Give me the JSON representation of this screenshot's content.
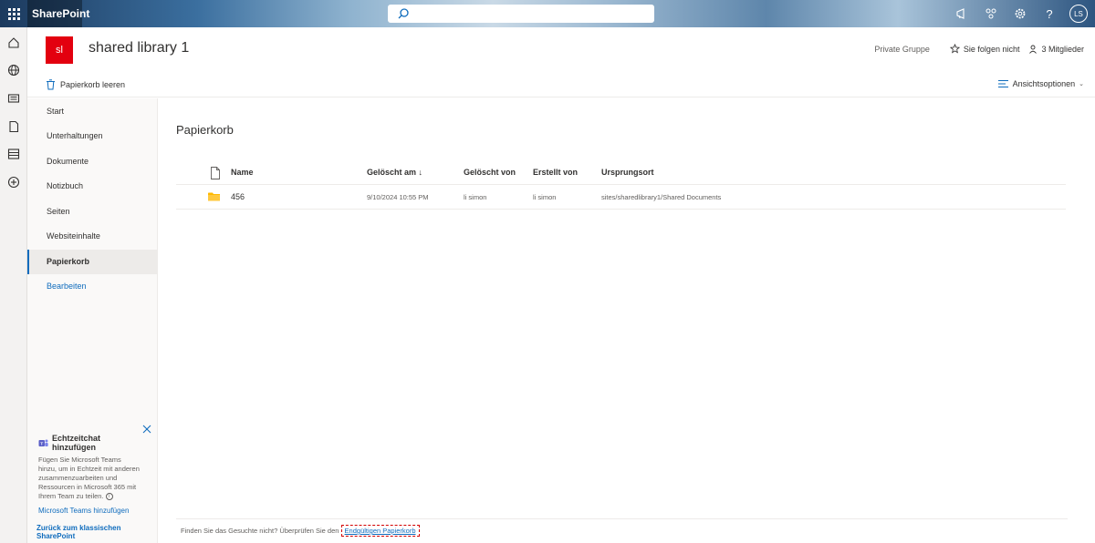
{
  "suite": {
    "brand": "SharePoint",
    "avatar_initials": "LS",
    "icons": [
      "megaphone-icon",
      "share-icon",
      "settings-icon",
      "help-icon"
    ],
    "help_glyph": "?"
  },
  "appbar": {
    "icons": [
      "home-icon",
      "globe-icon",
      "news-icon",
      "file-icon",
      "list-icon",
      "create-icon"
    ]
  },
  "site": {
    "logo_text": "sl",
    "title": "shared library 1",
    "privacy": "Private Gruppe",
    "follow": "Sie folgen nicht",
    "members": "3 Mitglieder"
  },
  "commandbar": {
    "empty_bin": "Papierkorb leeren",
    "view_options": "Ansichtsoptionen"
  },
  "nav": {
    "items": [
      {
        "label": "Start"
      },
      {
        "label": "Unterhaltungen"
      },
      {
        "label": "Dokumente"
      },
      {
        "label": "Notizbuch"
      },
      {
        "label": "Seiten"
      },
      {
        "label": "Websiteinhalte"
      },
      {
        "label": "Papierkorb"
      },
      {
        "label": "Bearbeiten"
      }
    ]
  },
  "teams_card": {
    "title": "Echtzeitchat hinzufügen",
    "body": "Fügen Sie Microsoft Teams hinzu, um in Echtzeit mit anderen zusammenzuarbeiten und Ressourcen in Microsoft 365 mit Ihrem Team zu teilen.",
    "link": "Microsoft Teams hinzufügen"
  },
  "classic_link": "Zurück zum klassischen SharePoint",
  "main": {
    "title": "Papierkorb",
    "columns": {
      "name": "Name",
      "deleted_on": "Gelöscht am ↓",
      "deleted_by": "Gelöscht von",
      "created_by": "Erstellt von",
      "origin": "Ursprungsort"
    },
    "rows": [
      {
        "name": "456",
        "deleted_on": "9/10/2024 10:55 PM",
        "deleted_by": "li simon",
        "created_by": "li simon",
        "origin": "sites/sharedlibrary1/Shared Documents"
      }
    ]
  },
  "footer": {
    "text": "Finden Sie das Gesuchte nicht? Überprüfen Sie den",
    "link": "Endgültigen Papierkorb"
  },
  "colors": {
    "accent": "#0f6cbd",
    "site_logo": "#e3000f",
    "folder": "#ffb900"
  }
}
